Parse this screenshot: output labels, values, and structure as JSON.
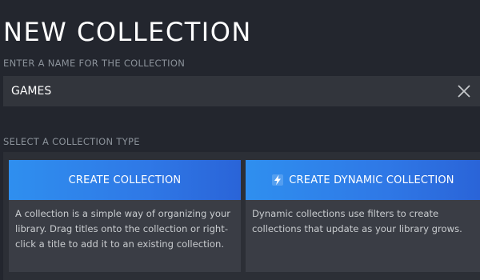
{
  "dialog": {
    "title": "NEW COLLECTION",
    "name_label": "ENTER A NAME FOR THE COLLECTION",
    "name_value": "GAMES",
    "clear_icon": "close-icon",
    "type_label": "SELECT A COLLECTION TYPE"
  },
  "options": [
    {
      "button_label": "CREATE COLLECTION",
      "description": "A collection is a simple way of organizing your library. Drag titles onto the collection or right-click a title to add it to an existing collection."
    },
    {
      "icon": "lightning-bolt-icon",
      "button_label": "CREATE DYNAMIC COLLECTION",
      "description": "Dynamic collections use filters to create collections that update as your library grows."
    }
  ],
  "colors": {
    "background": "#23262e",
    "accent": "#2f78e6",
    "input_bg": "#32353c",
    "card_desc_bg": "#3a3d45"
  }
}
